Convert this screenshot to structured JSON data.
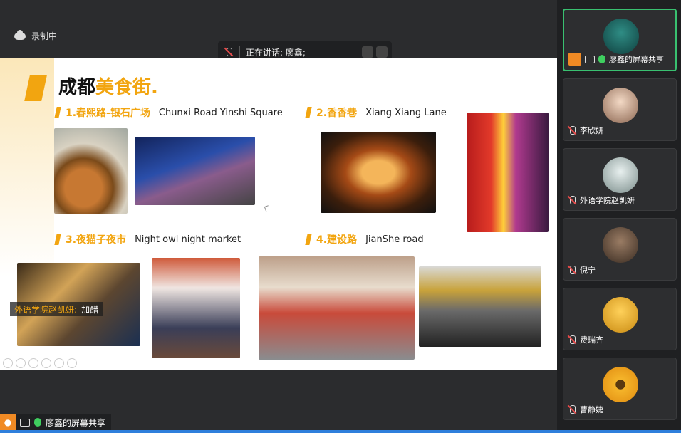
{
  "top": {
    "recording_label": "录制中",
    "speaking_label": "正在讲话: 廖鑫;"
  },
  "slide": {
    "title_main": "成都",
    "title_accent": "美食街",
    "title_suffix": ".",
    "sections": [
      {
        "cn": "1.春熙路-银石广场",
        "en": "Chunxi Road Yinshi Square"
      },
      {
        "cn": "2.香香巷",
        "en": "Xiang Xiang Lane"
      },
      {
        "cn": "3.夜猫子夜市",
        "en": "Night owl night market"
      },
      {
        "cn": "4.建设路",
        "en": "JianShe road"
      }
    ],
    "photos": [
      {
        "name": "food-platter-photo"
      },
      {
        "name": "chunxi-road-night-photo"
      },
      {
        "name": "xiangxiang-lane-gate-photo"
      },
      {
        "name": "neon-signs-street-photo"
      },
      {
        "name": "night-market-aerial-photo"
      },
      {
        "name": "street-vendor-photo"
      },
      {
        "name": "jianshe-road-crossing-photo"
      },
      {
        "name": "crowded-street-photo"
      }
    ],
    "overlay_label": {
      "org": "外语学院赵凯妍",
      "sep": ":",
      "action": "加醋"
    }
  },
  "bottom": {
    "share_tag": "廖鑫的屏幕共享"
  },
  "participants": [
    {
      "label": "廖鑫的屏幕共享",
      "active": true,
      "avatar_color": "#1e6b6a"
    },
    {
      "label": "李欣妍",
      "active": false,
      "avatar_color": "#d9b9a0"
    },
    {
      "label": "外语学院赵凯妍",
      "active": false,
      "avatar_color": "#b8c7c6"
    },
    {
      "label": "倪宁",
      "active": false,
      "avatar_color": "#6c5a4a"
    },
    {
      "label": "费瑞齐",
      "active": false,
      "avatar_color": "#f1b53a"
    },
    {
      "label": "曹静婕",
      "active": false,
      "avatar_color": "#f0a020"
    }
  ]
}
